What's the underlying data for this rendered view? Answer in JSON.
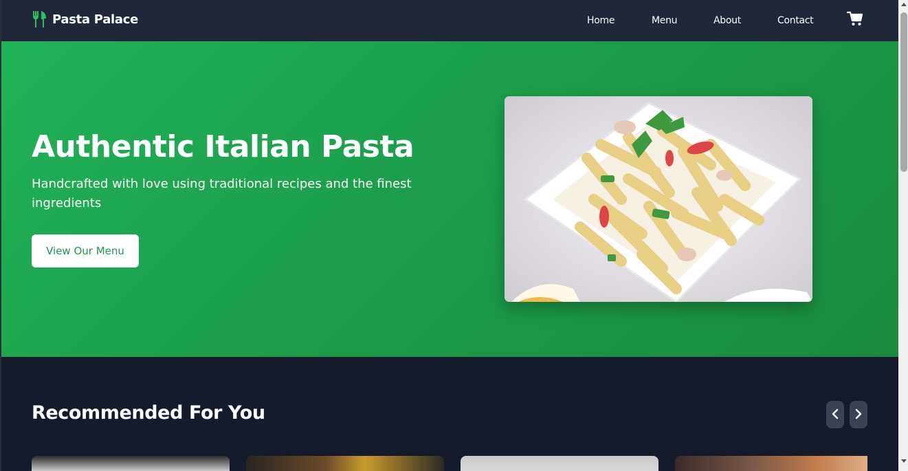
{
  "brand": {
    "name": "Pasta Palace",
    "icon": "utensils-icon",
    "accent": "#22c55e"
  },
  "nav": {
    "items": [
      {
        "label": "Home"
      },
      {
        "label": "Menu"
      },
      {
        "label": "About"
      },
      {
        "label": "Contact"
      }
    ],
    "cart_icon": "shopping-cart-icon"
  },
  "hero": {
    "title": "Authentic Italian Pasta",
    "subtitle": "Handcrafted with love using traditional recipes and the finest ingredients",
    "cta_label": "View Our Menu",
    "background": "#1f9e4c"
  },
  "recommended": {
    "title": "Recommended For You",
    "prev_icon": "chevron-left-icon",
    "next_icon": "chevron-right-icon"
  },
  "colors": {
    "navbar": "#1f2739",
    "page": "#161b2c",
    "hero": "#1f9e4c",
    "button_text": "#1b9a48"
  }
}
